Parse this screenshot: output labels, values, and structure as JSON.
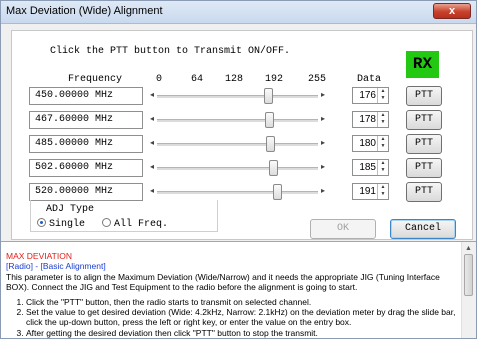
{
  "window": {
    "title": "Max Deviation (Wide) Alignment",
    "close_glyph": "x"
  },
  "instruction": "Click the PTT button to Transmit ON/OFF.",
  "status_indicator": {
    "text": "RX",
    "color": "#22c811"
  },
  "columns": {
    "frequency": "Frequency",
    "data": "Data",
    "scale": [
      "0",
      "64",
      "128",
      "192",
      "255"
    ]
  },
  "slider": {
    "min": 0,
    "max": 255
  },
  "rows": [
    {
      "frequency": "450.00000 MHz",
      "value": 176,
      "ptt": "PTT"
    },
    {
      "frequency": "467.60000 MHz",
      "value": 178,
      "ptt": "PTT"
    },
    {
      "frequency": "485.00000 MHz",
      "value": 180,
      "ptt": "PTT"
    },
    {
      "frequency": "502.60000 MHz",
      "value": 185,
      "ptt": "PTT"
    },
    {
      "frequency": "520.00000 MHz",
      "value": 191,
      "ptt": "PTT"
    }
  ],
  "adj_type": {
    "label": "ADJ Type",
    "options": [
      "Single",
      "All Freq."
    ],
    "selected": "Single"
  },
  "buttons": {
    "ok": "OK",
    "cancel": "Cancel"
  },
  "help": {
    "title": "MAX DEVIATION",
    "breadcrumb": "[Radio] - [Basic Alignment]",
    "intro": "This parameter is to align the Maximum Deviation (Wide/Narrow) and it needs the appropriate JIG (Tuning Interface BOX). Connect the JIG and Test Equipment to the radio before the alignment is going to start.",
    "steps": [
      "Click the \"PTT\" button, then the radio starts to transmit on selected channel.",
      "Set the value to get desired deviation (Wide: 4.2kHz, Narrow: 2.1kHz) on the deviation meter by drag the slide bar, click the up-down button, press the left or right key, or enter the value on the entry box.",
      "After getting the desired deviation then click \"PTT\" button to stop the transmit."
    ]
  }
}
